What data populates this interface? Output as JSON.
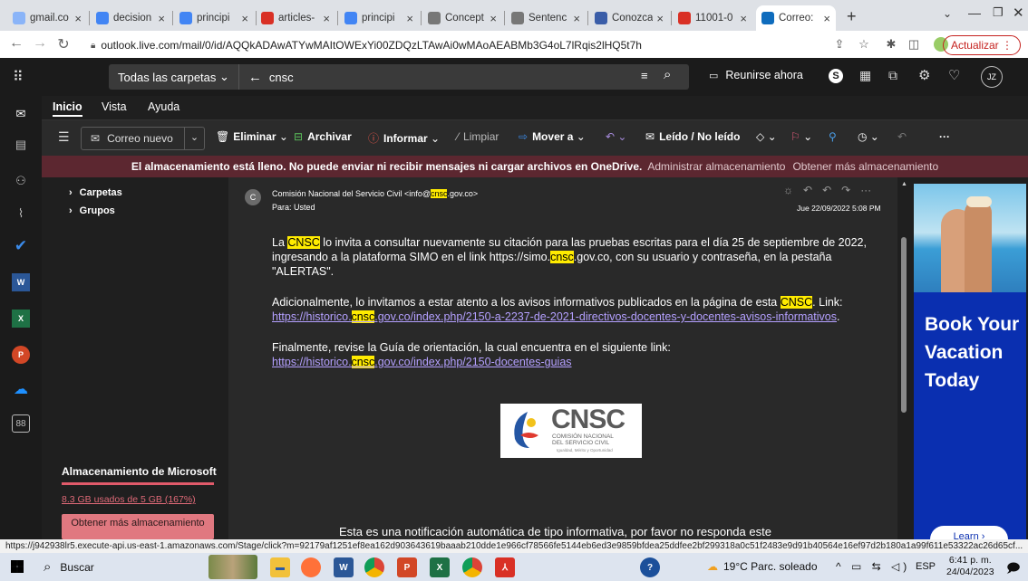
{
  "browser": {
    "tabs": [
      {
        "label": "gmail.co",
        "icon": "chrome-icon",
        "color": "#8ab4f8"
      },
      {
        "label": "decision",
        "icon": "google-icon",
        "color": "#4285f4"
      },
      {
        "label": "principi",
        "icon": "google-icon",
        "color": "#4285f4"
      },
      {
        "label": "articles-",
        "icon": "pdf-icon",
        "color": "#d93025"
      },
      {
        "label": "principi",
        "icon": "google-icon",
        "color": "#4285f4"
      },
      {
        "label": "Concept",
        "icon": "shield-icon",
        "color": "#777"
      },
      {
        "label": "Sentenc",
        "icon": "shield-icon",
        "color": "#777"
      },
      {
        "label": "Conozca",
        "icon": "gov-icon",
        "color": "#3a5da8"
      },
      {
        "label": "11001-0",
        "icon": "pdf-icon",
        "color": "#d93025"
      },
      {
        "label": "Correo:",
        "icon": "outlook-icon",
        "color": "#0f6cbd"
      }
    ],
    "url": "outlook.live.com/mail/0/id/AQQkADAwATYwMAItOWExYi00ZDQzLTAwAi0wMAoAEABMb3G4oL7lRqis2lHQ5t7h",
    "update_label": "Actualizar",
    "status_url": "https://j942938lr5.execute-api.us-east-1.amazonaws.com/Stage/click?m=92179af1251ef8ea162d903643619baaab210dde1e966cf78566fe5144eb6ed3e9859bfdea25ddfee2bf299318a0c51f2483e9d91b40564e16ef97d2b180a1a99f611e53322ac26d65cf..."
  },
  "outlook": {
    "folder_scope": "Todas las carpetas",
    "search_value": "cnsc",
    "meet_now": "Reunirse ahora",
    "avatar": "JZ",
    "ribbon_tabs": [
      "Inicio",
      "Vista",
      "Ayuda"
    ],
    "new_mail": "Correo nuevo",
    "actions": {
      "delete": "Eliminar",
      "archive": "Archivar",
      "report": "Informar",
      "sweep": "Limpiar",
      "move": "Mover a",
      "read_unread": "Leído / No leído"
    },
    "banner": {
      "message": "El almacenamiento está lleno. No puede enviar ni recibir mensajes ni cargar archivos en OneDrive.",
      "manage": "Administrar almacenamiento",
      "get_more": "Obtener más almacenamiento"
    },
    "folders": [
      "Carpetas",
      "Grupos"
    ],
    "storage": {
      "title": "Almacenamiento de Microsoft",
      "usage": "8.3 GB usados de 5 GB (167%)",
      "fill_percent": 100,
      "button": "Obtener más almacenamiento"
    }
  },
  "email": {
    "sender_initial": "C",
    "sender_name": "Comisión Nacional del Servicio Civil <info@",
    "sender_hl": "cnsc",
    "sender_tail": ".gov.co>",
    "to": "Para: Usted",
    "date": "Jue 22/09/2022 5:08 PM",
    "p1_a": "La ",
    "p1_hl": "CNSC",
    "p1_b": " lo invita a consultar nuevamente su citación para las pruebas escritas para el día 25 de septiembre de 2022, ingresando a la plataforma SIMO en el link https://simo.",
    "p1_hl2": "cnsc",
    "p1_c": ".gov.co, con su usuario y contraseña, en la pestaña \"ALERTAS\".",
    "p2_a": "Adicionalmente, lo invitamos a estar atento a los avisos informativos publicados en la página de esta ",
    "p2_hl": "CNSC",
    "p2_b": ". Link:",
    "link1_a": "https://historico.",
    "link1_hl": "cnsc",
    "link1_b": ".gov.co/index.php/2150-a-2237-de-2021-directivos-docentes-y-docentes-avisos-informativos",
    "link1_dot": ".",
    "p3": "Finalmente, revise la Guía de orientación, la cual encuentra en el siguiente link:",
    "link2_a": "https://historico.",
    "link2_hl": "cnsc",
    "link2_b": ".gov.co/index.php/2150-docentes-guias",
    "logo_text": "CNSC",
    "logo_sub1": "COMISIÓN NACIONAL",
    "logo_sub2": "DEL SERVICIO CIVIL",
    "logo_sub3": "Igualdad, Mérito y Oportunidad",
    "footer": "Esta es una notificación automática de tipo informativa, por favor no responda este"
  },
  "ad": {
    "headline": "Book Your Vacation Today",
    "cta": "Learn"
  },
  "taskbar": {
    "search": "Buscar",
    "weather": "19°C Parc. soleado",
    "lang": "ESP",
    "time": "6:41 p. m.",
    "date": "24/04/2023"
  }
}
